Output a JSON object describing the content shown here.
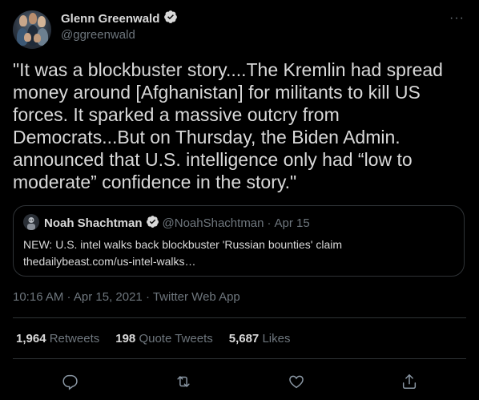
{
  "author": {
    "name": "Glenn Greenwald",
    "handle": "@ggreenwald"
  },
  "tweet": {
    "text": "\"It was a blockbuster story....The Kremlin had spread money around [Afghanistan] for militants to kill US forces. It sparked a massive outcry from Democrats...But on Thursday, the Biden Admin. announced that U.S. intelligence only had “low to moderate” confidence in the story.\"",
    "timestamp": "10:16 AM · Apr 15, 2021 · Twitter Web App"
  },
  "quoted_tweet": {
    "name": "Noah Shachtman",
    "handle": "@NoahShachtman",
    "separator": "·",
    "date": "Apr 15",
    "text": "NEW: U.S. intel walks back blockbuster 'Russian bounties' claim",
    "link": "thedailybeast.com/us-intel-walks…"
  },
  "stats": {
    "retweets_count": "1,964",
    "retweets_label": "Retweets",
    "quote_count": "198",
    "quote_label": "Quote Tweets",
    "likes_count": "5,687",
    "likes_label": "Likes"
  },
  "more_label": "···",
  "icons": [
    "verified-icon",
    "more-icon",
    "reply-icon",
    "retweet-icon",
    "like-icon",
    "share-icon"
  ],
  "colors": {
    "background": "#000000",
    "text": "#d9d9d9",
    "secondary": "#6e767d",
    "border": "#2f3336",
    "verified_badge": "#d9d9d9"
  }
}
